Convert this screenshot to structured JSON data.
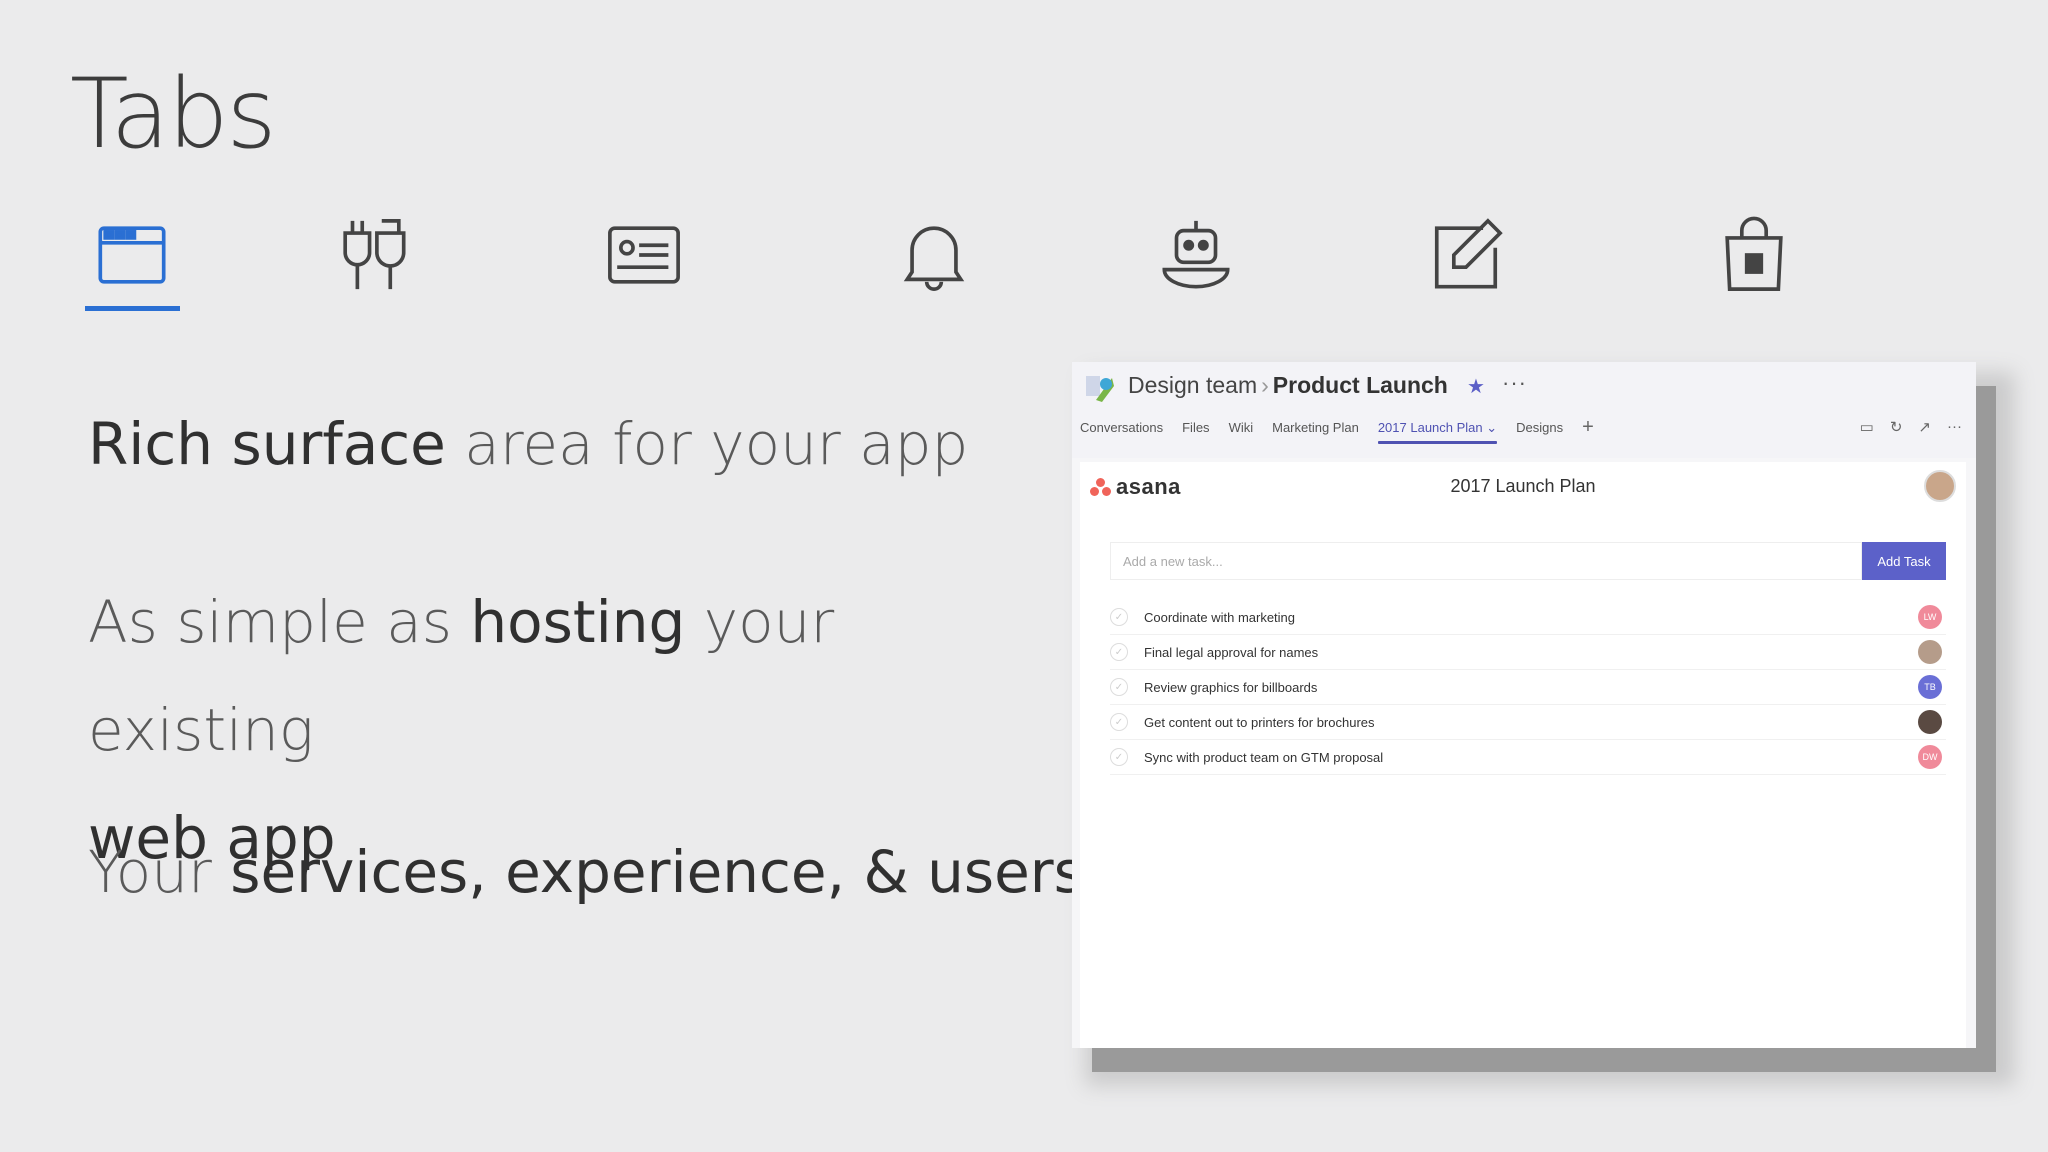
{
  "slide": {
    "title": "Tabs",
    "icons": [
      "tab-browser-icon",
      "plug-connectors-icon",
      "card-id-icon",
      "bell-icon",
      "bot-icon",
      "compose-icon",
      "store-bag-icon"
    ],
    "accent": "#2a6fd3",
    "bullets": [
      {
        "bold": "Rich surface",
        "rest": " area for your app"
      },
      {
        "pre": "As simple as ",
        "bold": "hosting",
        "mid": " your existing ",
        "bold2": "web app"
      },
      {
        "pre": "Your ",
        "bold": "services, experience, & users"
      }
    ]
  },
  "teams": {
    "team": "Design team",
    "channel": "Product Launch",
    "more": "···",
    "tabs": [
      "Conversations",
      "Files",
      "Wiki",
      "Marketing Plan",
      "2017 Launch Plan",
      "Designs"
    ],
    "active_tab": "2017 Launch Plan",
    "accent": "#4f52b2"
  },
  "app": {
    "brand": "asana",
    "title": "2017 Launch Plan",
    "input_placeholder": "Add a new task...",
    "add_label": "Add Task",
    "tasks": [
      {
        "label": "Coordinate with marketing",
        "assignee": "LW",
        "color": "#f08a9a"
      },
      {
        "label": "Final legal approval for names",
        "assignee": "",
        "color": "#b59c8a"
      },
      {
        "label": "Review graphics for billboards",
        "assignee": "TB",
        "color": "#6a6fd6"
      },
      {
        "label": "Get content out to printers for brochures",
        "assignee": "",
        "color": "#5a4a42"
      },
      {
        "label": "Sync with product team on GTM proposal",
        "assignee": "DW",
        "color": "#f08a9a"
      }
    ]
  }
}
